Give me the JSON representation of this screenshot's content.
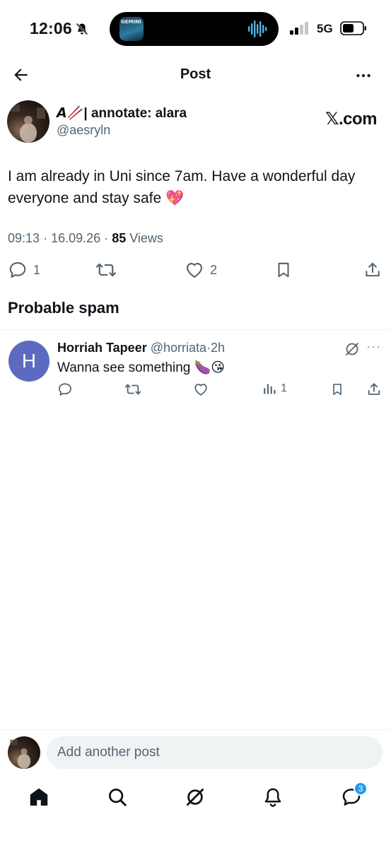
{
  "status_bar": {
    "time": "12:06",
    "network": "5G",
    "now_playing_art_text": "GEMINI"
  },
  "header": {
    "title": "Post"
  },
  "post": {
    "author_name": "𝘼🥢| annotate: alara",
    "author_handle": "@aesryln",
    "source": "𝕏.com",
    "text": "I am already in Uni since 7am. Have a wonderful day everyone and stay safe 💖",
    "time": "09:13",
    "date": "16.09.26",
    "views_count": "85",
    "views_label": "Views",
    "replies": "1",
    "likes": "2"
  },
  "section_heading": "Probable spam",
  "reply": {
    "avatar_letter": "H",
    "name": "Horriah Tapeer",
    "handle": "@horriata",
    "age": "2h",
    "text": "Wanna see something 🍆😘",
    "views": "1"
  },
  "composer": {
    "placeholder": "Add another post"
  },
  "tabbar": {
    "messages_badge": "3"
  },
  "colors": {
    "accent": "#1d9bf0",
    "secondary_text": "#536471",
    "reply_avatar": "#5c6bc0"
  }
}
